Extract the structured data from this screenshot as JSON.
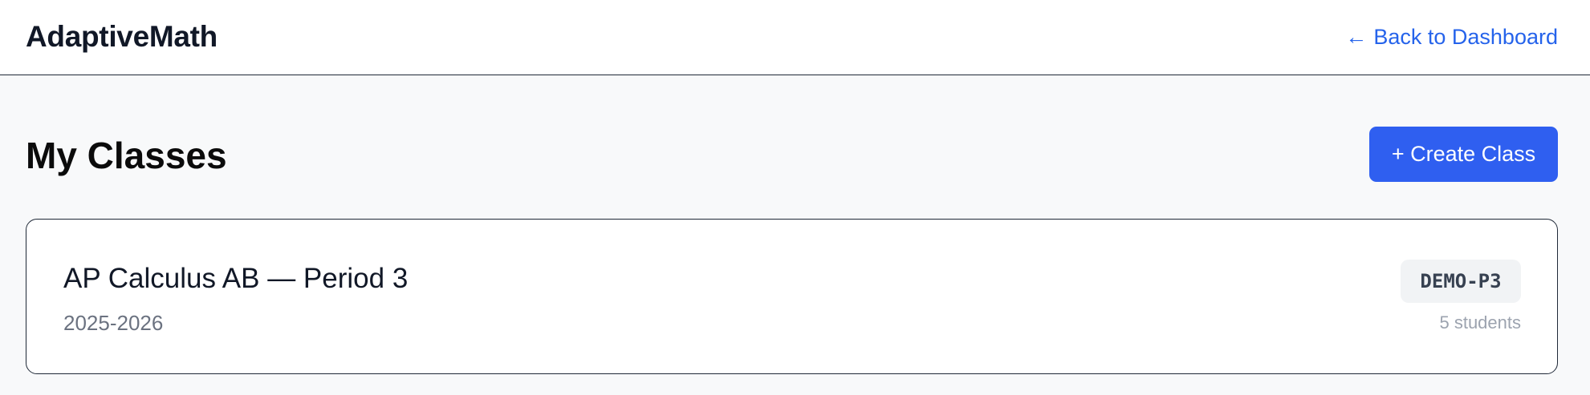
{
  "header": {
    "brand": "AdaptiveMath",
    "back_arrow": "←",
    "back_label": "Back to Dashboard"
  },
  "main": {
    "title": "My Classes",
    "create_button_label": "+ Create Class",
    "classes": [
      {
        "name": "AP Calculus AB — Period 3",
        "year": "2025-2026",
        "code": "DEMO-P3",
        "students": "5 students"
      }
    ]
  },
  "colors": {
    "accent": "#2f5ff0",
    "link": "#2563eb",
    "background": "#f8f9fa",
    "text_primary": "#111827",
    "text_muted": "#6b7280"
  }
}
